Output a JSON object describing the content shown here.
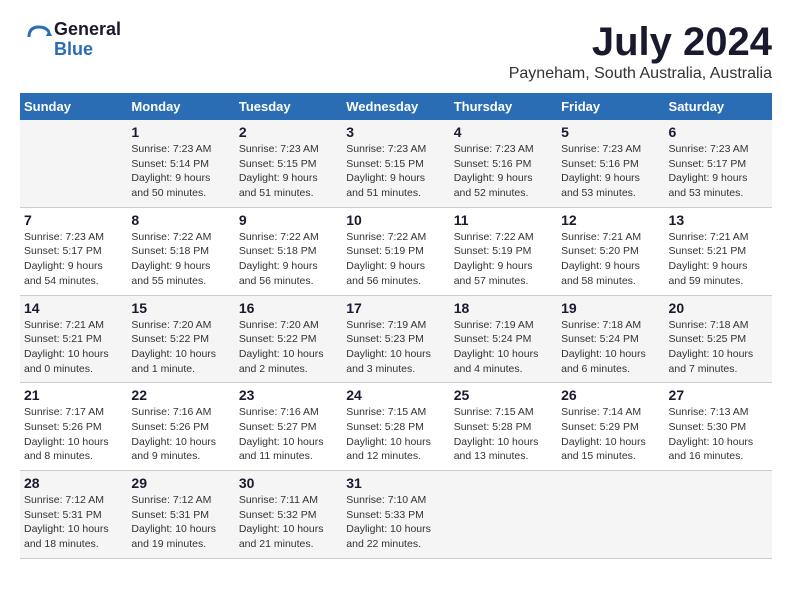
{
  "header": {
    "logo_general": "General",
    "logo_blue": "Blue",
    "title": "July 2024",
    "subtitle": "Payneham, South Australia, Australia"
  },
  "weekdays": [
    "Sunday",
    "Monday",
    "Tuesday",
    "Wednesday",
    "Thursday",
    "Friday",
    "Saturday"
  ],
  "weeks": [
    [
      {
        "day": "",
        "info": ""
      },
      {
        "day": "1",
        "info": "Sunrise: 7:23 AM\nSunset: 5:14 PM\nDaylight: 9 hours\nand 50 minutes."
      },
      {
        "day": "2",
        "info": "Sunrise: 7:23 AM\nSunset: 5:15 PM\nDaylight: 9 hours\nand 51 minutes."
      },
      {
        "day": "3",
        "info": "Sunrise: 7:23 AM\nSunset: 5:15 PM\nDaylight: 9 hours\nand 51 minutes."
      },
      {
        "day": "4",
        "info": "Sunrise: 7:23 AM\nSunset: 5:16 PM\nDaylight: 9 hours\nand 52 minutes."
      },
      {
        "day": "5",
        "info": "Sunrise: 7:23 AM\nSunset: 5:16 PM\nDaylight: 9 hours\nand 53 minutes."
      },
      {
        "day": "6",
        "info": "Sunrise: 7:23 AM\nSunset: 5:17 PM\nDaylight: 9 hours\nand 53 minutes."
      }
    ],
    [
      {
        "day": "7",
        "info": "Sunrise: 7:23 AM\nSunset: 5:17 PM\nDaylight: 9 hours\nand 54 minutes."
      },
      {
        "day": "8",
        "info": "Sunrise: 7:22 AM\nSunset: 5:18 PM\nDaylight: 9 hours\nand 55 minutes."
      },
      {
        "day": "9",
        "info": "Sunrise: 7:22 AM\nSunset: 5:18 PM\nDaylight: 9 hours\nand 56 minutes."
      },
      {
        "day": "10",
        "info": "Sunrise: 7:22 AM\nSunset: 5:19 PM\nDaylight: 9 hours\nand 56 minutes."
      },
      {
        "day": "11",
        "info": "Sunrise: 7:22 AM\nSunset: 5:19 PM\nDaylight: 9 hours\nand 57 minutes."
      },
      {
        "day": "12",
        "info": "Sunrise: 7:21 AM\nSunset: 5:20 PM\nDaylight: 9 hours\nand 58 minutes."
      },
      {
        "day": "13",
        "info": "Sunrise: 7:21 AM\nSunset: 5:21 PM\nDaylight: 9 hours\nand 59 minutes."
      }
    ],
    [
      {
        "day": "14",
        "info": "Sunrise: 7:21 AM\nSunset: 5:21 PM\nDaylight: 10 hours\nand 0 minutes."
      },
      {
        "day": "15",
        "info": "Sunrise: 7:20 AM\nSunset: 5:22 PM\nDaylight: 10 hours\nand 1 minute."
      },
      {
        "day": "16",
        "info": "Sunrise: 7:20 AM\nSunset: 5:22 PM\nDaylight: 10 hours\nand 2 minutes."
      },
      {
        "day": "17",
        "info": "Sunrise: 7:19 AM\nSunset: 5:23 PM\nDaylight: 10 hours\nand 3 minutes."
      },
      {
        "day": "18",
        "info": "Sunrise: 7:19 AM\nSunset: 5:24 PM\nDaylight: 10 hours\nand 4 minutes."
      },
      {
        "day": "19",
        "info": "Sunrise: 7:18 AM\nSunset: 5:24 PM\nDaylight: 10 hours\nand 6 minutes."
      },
      {
        "day": "20",
        "info": "Sunrise: 7:18 AM\nSunset: 5:25 PM\nDaylight: 10 hours\nand 7 minutes."
      }
    ],
    [
      {
        "day": "21",
        "info": "Sunrise: 7:17 AM\nSunset: 5:26 PM\nDaylight: 10 hours\nand 8 minutes."
      },
      {
        "day": "22",
        "info": "Sunrise: 7:16 AM\nSunset: 5:26 PM\nDaylight: 10 hours\nand 9 minutes."
      },
      {
        "day": "23",
        "info": "Sunrise: 7:16 AM\nSunset: 5:27 PM\nDaylight: 10 hours\nand 11 minutes."
      },
      {
        "day": "24",
        "info": "Sunrise: 7:15 AM\nSunset: 5:28 PM\nDaylight: 10 hours\nand 12 minutes."
      },
      {
        "day": "25",
        "info": "Sunrise: 7:15 AM\nSunset: 5:28 PM\nDaylight: 10 hours\nand 13 minutes."
      },
      {
        "day": "26",
        "info": "Sunrise: 7:14 AM\nSunset: 5:29 PM\nDaylight: 10 hours\nand 15 minutes."
      },
      {
        "day": "27",
        "info": "Sunrise: 7:13 AM\nSunset: 5:30 PM\nDaylight: 10 hours\nand 16 minutes."
      }
    ],
    [
      {
        "day": "28",
        "info": "Sunrise: 7:12 AM\nSunset: 5:31 PM\nDaylight: 10 hours\nand 18 minutes."
      },
      {
        "day": "29",
        "info": "Sunrise: 7:12 AM\nSunset: 5:31 PM\nDaylight: 10 hours\nand 19 minutes."
      },
      {
        "day": "30",
        "info": "Sunrise: 7:11 AM\nSunset: 5:32 PM\nDaylight: 10 hours\nand 21 minutes."
      },
      {
        "day": "31",
        "info": "Sunrise: 7:10 AM\nSunset: 5:33 PM\nDaylight: 10 hours\nand 22 minutes."
      },
      {
        "day": "",
        "info": ""
      },
      {
        "day": "",
        "info": ""
      },
      {
        "day": "",
        "info": ""
      }
    ]
  ]
}
